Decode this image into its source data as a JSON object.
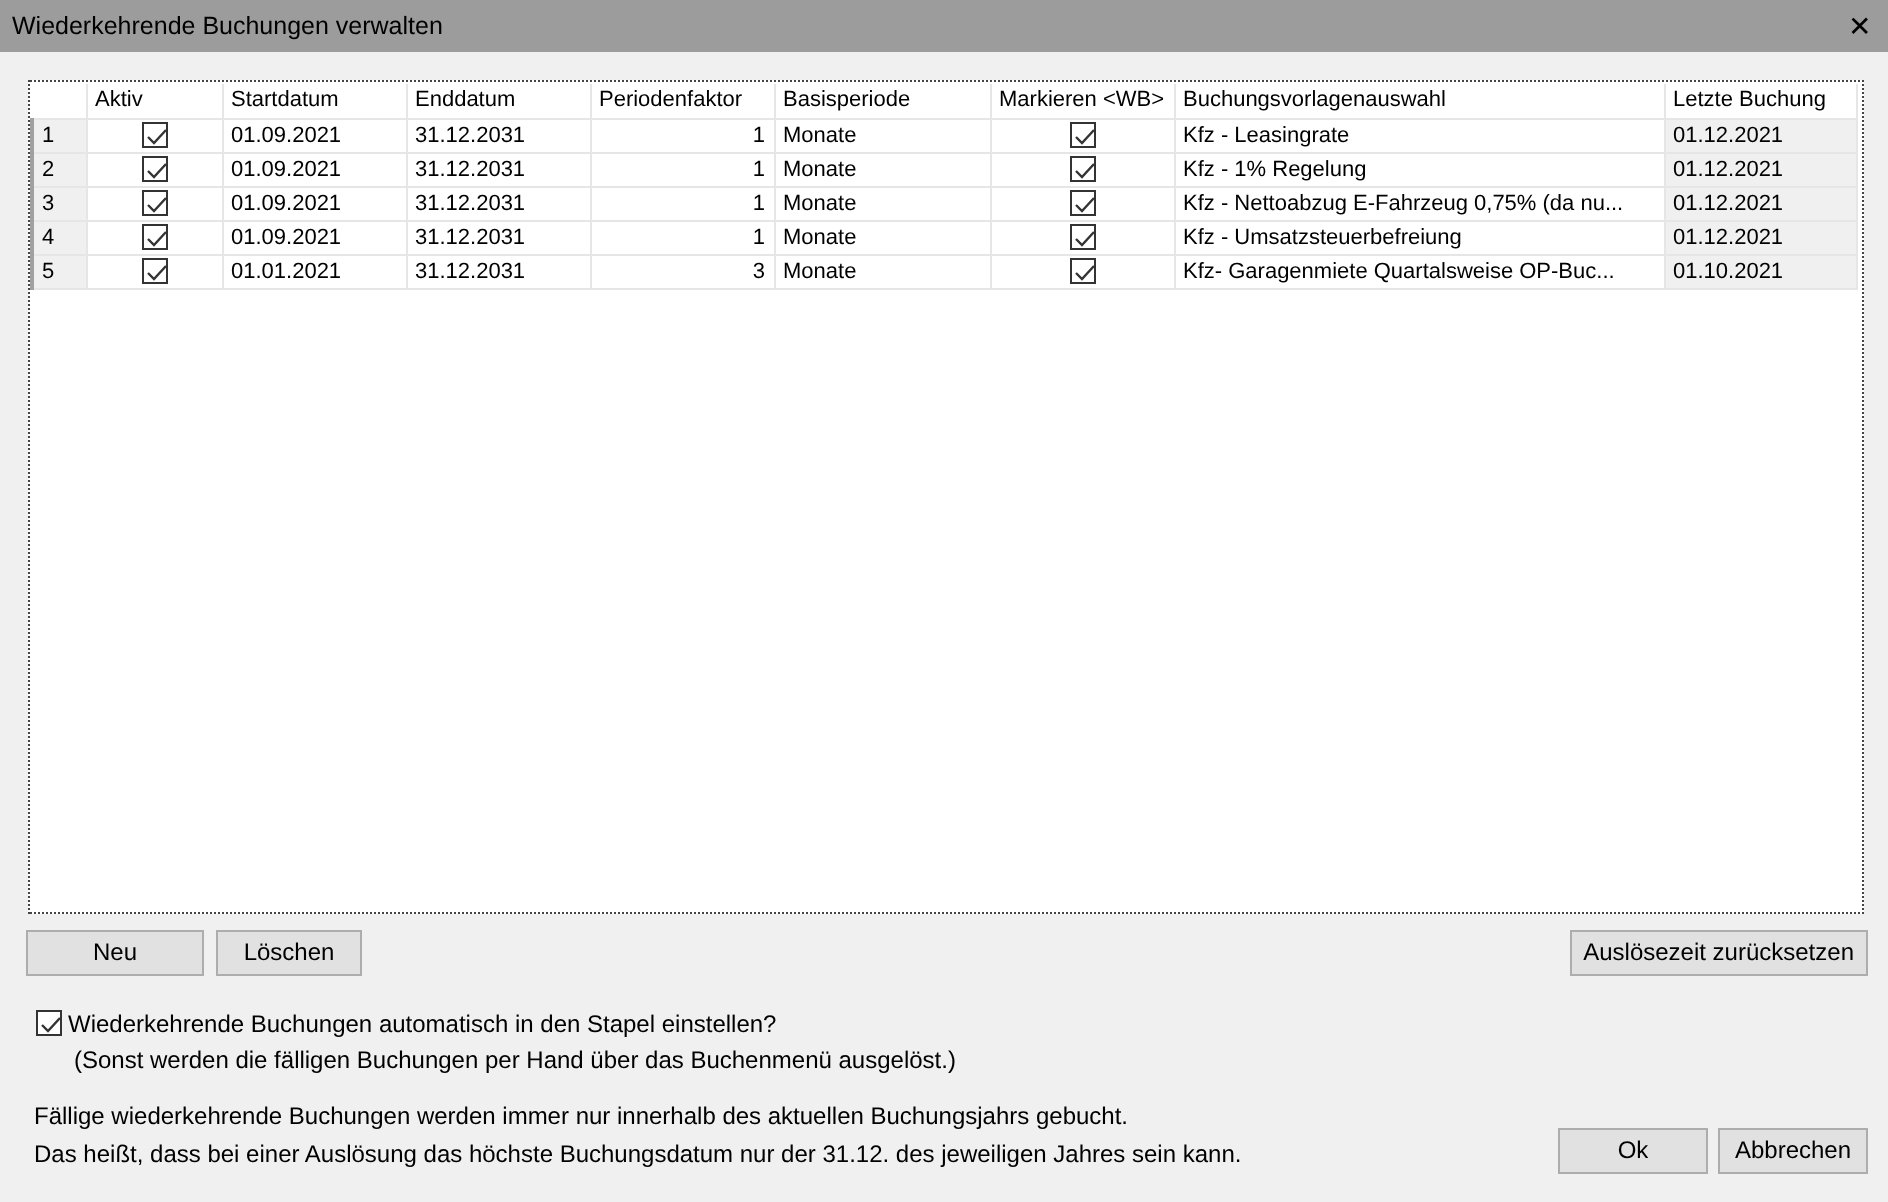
{
  "window": {
    "title": "Wiederkehrende Buchungen verwalten",
    "close": "✕"
  },
  "table": {
    "columns": [
      "Aktiv",
      "Startdatum",
      "Enddatum",
      "Periodenfaktor",
      "Basisperiode",
      "Markieren <WB>",
      "Buchungsvorlagenauswahl",
      "Letzte Buchung"
    ],
    "rows": [
      {
        "number": "1",
        "aktiv": true,
        "start": "01.09.2021",
        "end": "31.12.2031",
        "factor": "1",
        "period": "Monate",
        "mark": true,
        "template": "Kfz - Leasingrate",
        "last": "01.12.2021"
      },
      {
        "number": "2",
        "aktiv": true,
        "start": "01.09.2021",
        "end": "31.12.2031",
        "factor": "1",
        "period": "Monate",
        "mark": true,
        "template": "Kfz - 1% Regelung",
        "last": "01.12.2021"
      },
      {
        "number": "3",
        "aktiv": true,
        "start": "01.09.2021",
        "end": "31.12.2031",
        "factor": "1",
        "period": "Monate",
        "mark": true,
        "template": "Kfz - Nettoabzug E-Fahrzeug 0,75% (da nu...",
        "last": "01.12.2021"
      },
      {
        "number": "4",
        "aktiv": true,
        "start": "01.09.2021",
        "end": "31.12.2031",
        "factor": "1",
        "period": "Monate",
        "mark": true,
        "template": "Kfz - Umsatzsteuerbefreiung",
        "last": "01.12.2021"
      },
      {
        "number": "5",
        "aktiv": true,
        "start": "01.01.2021",
        "end": "31.12.2031",
        "factor": "3",
        "period": "Monate",
        "mark": true,
        "template": "Kfz- Garagenmiete Quartalsweise OP-Buc...",
        "last": "01.10.2021"
      }
    ]
  },
  "row_buttons": [
    "Neu",
    "Löschen"
  ],
  "reset_button": "Auslösezeit zurücksetzen",
  "auto_option": {
    "label": "Wiederkehrende Buchungen automatisch in den Stapel einstellen?",
    "checked": true,
    "hint": "(Sonst werden die fälligen Buchungen per Hand über das Buchenmenü ausgelöst.)"
  },
  "info": [
    "Fällige wiederkehrende Buchungen werden immer nur innerhalb des aktuellen Buchungsjahrs gebucht.",
    "Das heißt, dass bei einer Auslösung das höchste Buchungsdatum nur der 31.12. des jeweiligen Jahres sein kann."
  ],
  "dialog_buttons": [
    "Ok",
    "Abbrechen"
  ]
}
